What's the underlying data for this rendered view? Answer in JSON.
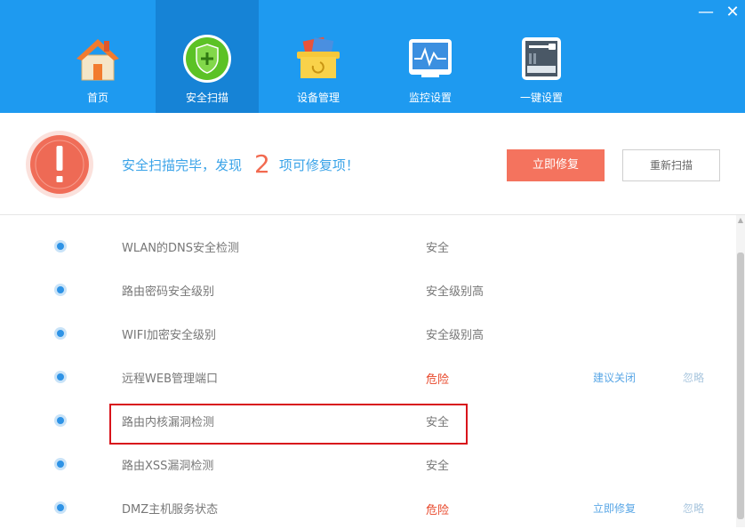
{
  "window": {
    "minimize_glyph": "—",
    "close_glyph": "✕"
  },
  "nav": {
    "items": [
      {
        "label": "首页",
        "icon": "home-icon",
        "active": false
      },
      {
        "label": "安全扫描",
        "icon": "shield-plus-icon",
        "active": true
      },
      {
        "label": "设备管理",
        "icon": "device-box-icon",
        "active": false
      },
      {
        "label": "监控设置",
        "icon": "monitor-icon",
        "active": false
      },
      {
        "label": "一键设置",
        "icon": "router-icon",
        "active": false
      }
    ]
  },
  "summary": {
    "prefix": "安全扫描完毕，发现",
    "count": "2",
    "suffix": "项可修复项！",
    "fix_button": "立即修复",
    "rescan_button": "重新扫描",
    "warning_icon": "warning-exclamation-icon"
  },
  "results": [
    {
      "name": "WLAN的DNS安全检测",
      "status": "安全",
      "danger": false,
      "action": "",
      "ignore": ""
    },
    {
      "name": "路由密码安全级别",
      "status": "安全级别高",
      "danger": false,
      "action": "",
      "ignore": ""
    },
    {
      "name": "WIFI加密安全级别",
      "status": "安全级别高",
      "danger": false,
      "action": "",
      "ignore": ""
    },
    {
      "name": "远程WEB管理端口",
      "status": "危险",
      "danger": true,
      "action": "建议关闭",
      "ignore": "忽略"
    },
    {
      "name": "路由内核漏洞检测",
      "status": "安全",
      "danger": false,
      "action": "",
      "ignore": "",
      "highlighted": true
    },
    {
      "name": "路由XSS漏洞检测",
      "status": "安全",
      "danger": false,
      "action": "",
      "ignore": ""
    },
    {
      "name": "DMZ主机服务状态",
      "status": "危险",
      "danger": true,
      "action": "立即修复",
      "ignore": "忽略"
    }
  ],
  "colors": {
    "header_blue": "#1e9af0",
    "active_tab": "#1683d6",
    "accent_red": "#f4735e",
    "danger_text": "#e8472a",
    "link_blue": "#5aa7e6",
    "highlight_border": "#d8141b"
  }
}
